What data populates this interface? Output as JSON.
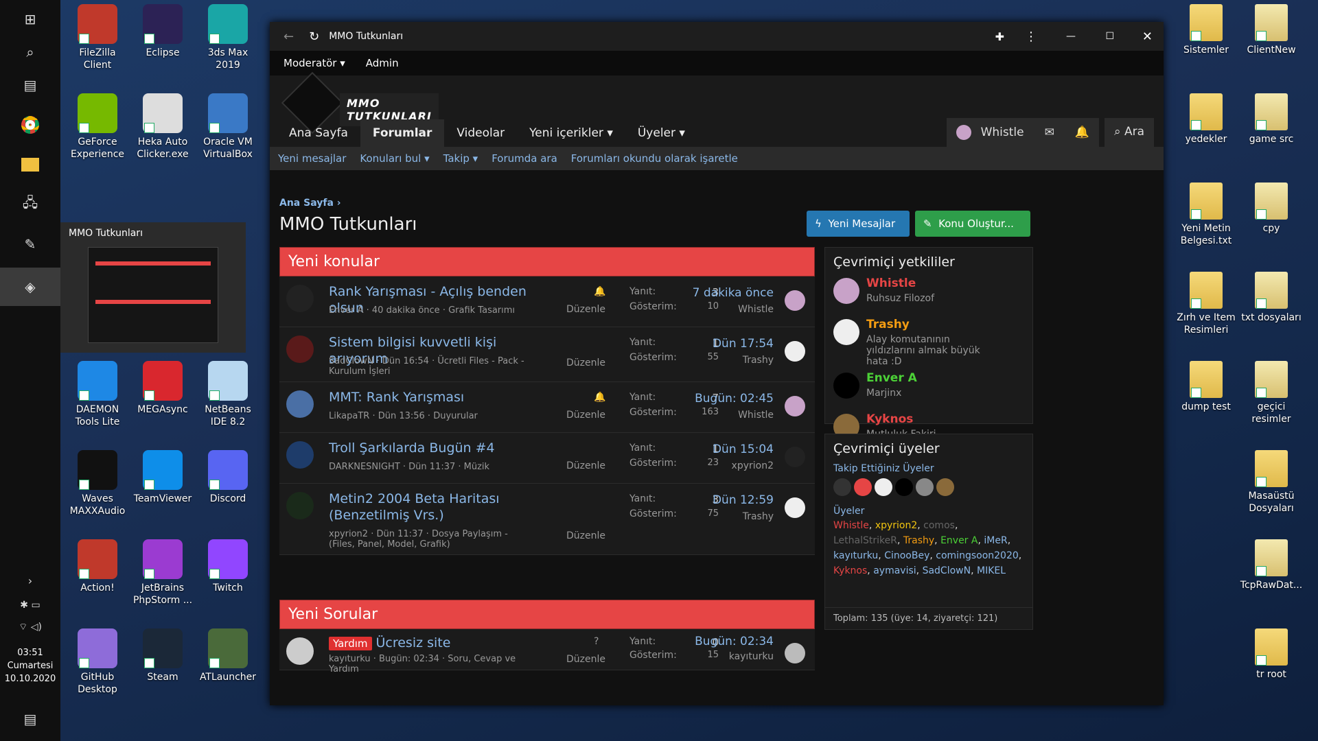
{
  "window_title": "MMO Tutkunları",
  "taskbar": {
    "clock_time": "03:51",
    "clock_day": "Cumartesi",
    "clock_date": "10.10.2020",
    "thumb_title": "MMO Tutkunları"
  },
  "desktop_left": [
    {
      "label": "FileZilla Client",
      "color": "#c0392b"
    },
    {
      "label": "Eclipse",
      "color": "#2c2255"
    },
    {
      "label": "3ds Max 2019",
      "color": "#1aa6a6"
    },
    {
      "label": "GeForce Experience",
      "color": "#76b900"
    },
    {
      "label": "Heka Auto Clicker.exe",
      "color": "#ddd"
    },
    {
      "label": "Oracle VM VirtualBox",
      "color": "#3a79c6"
    },
    {
      "label": "DAEMON Tools Lite",
      "color": "#1e88e5"
    },
    {
      "label": "MEGAsync",
      "color": "#d9272e"
    },
    {
      "label": "NetBeans IDE 8.2",
      "color": "#b7d7f0"
    },
    {
      "label": "Waves MAXXAudio",
      "color": "#111"
    },
    {
      "label": "TeamViewer",
      "color": "#0e8ee9"
    },
    {
      "label": "Discord",
      "color": "#5865f2"
    },
    {
      "label": "Action!",
      "color": "#c0392b"
    },
    {
      "label": "JetBrains PhpStorm ...",
      "color": "#9b3bd1"
    },
    {
      "label": "Twitch",
      "color": "#9146ff"
    },
    {
      "label": "GitHub Desktop",
      "color": "#8e6cd9"
    },
    {
      "label": "Steam",
      "color": "#1b2838"
    },
    {
      "label": "ATLauncher",
      "color": "#4a6a3a"
    }
  ],
  "desktop_right": [
    {
      "label": "Sistemler"
    },
    {
      "label": "ClientNew"
    },
    {
      "label": "yedekler"
    },
    {
      "label": "game src"
    },
    {
      "label": "Yeni Metin Belgesi.txt"
    },
    {
      "label": "cpy"
    },
    {
      "label": "Zırh ve Item Resimleri"
    },
    {
      "label": "txt dosyaları"
    },
    {
      "label": "dump test"
    },
    {
      "label": "geçici resimler"
    },
    {
      "label": "Masaüstü Dosyaları"
    },
    {
      "label": "TcpRawDat..."
    },
    {
      "label": "tr root"
    }
  ],
  "modbar": {
    "moderator": "Moderatör ▾",
    "admin": "Admin"
  },
  "logo_text": "MMO TUTKUNLARI",
  "nav": [
    "Ana Sayfa",
    "Forumlar",
    "Videolar",
    "Yeni içerikler ▾",
    "Üyeler ▾"
  ],
  "nav_user": "Whistle",
  "nav_search": "Ara",
  "subnav": [
    "Yeni mesajlar",
    "Konuları bul ▾",
    "Takip ▾",
    "Forumda ara",
    "Forumları okundu olarak işaretle"
  ],
  "breadcrumb": "Ana Sayfa",
  "page_title": "MMO Tutkunları",
  "btn_new_posts": "Yeni Mesajlar",
  "btn_create": "Konu Oluştur...",
  "section1": "Yeni konular",
  "section2": "Yeni Sorular",
  "labels": {
    "reply": "Yanıt:",
    "views": "Gösterim:",
    "edit": "Düzenle"
  },
  "topics": [
    {
      "title": "Rank Yarışması - Açılış benden olsun",
      "meta": "Enver A · 40 dakika önce · Grafik Tasarımı",
      "replies": "3",
      "views": "10",
      "when": "7 dakika önce",
      "last": "Whistle",
      "bell": true
    },
    {
      "title": "Sistem bilgisi kuvvetli kişi arıyorum",
      "meta": "SadClowN · Dün 16:54 · Ücretli Files - Pack - Kurulum İşleri",
      "replies": "1",
      "views": "55",
      "when": "Dün 17:54",
      "last": "Trashy",
      "bell": false
    },
    {
      "title": "MMT: Rank Yarışması",
      "meta": "LikapaTR · Dün 13:56 · Duyurular",
      "replies": "7",
      "views": "163",
      "when": "Bugün: 02:45",
      "last": "Whistle",
      "bell": true
    },
    {
      "title": "Troll Şarkılarda Bugün #4",
      "meta": "DARKNESNIGHT · Dün 11:37 · Müzik",
      "replies": "1",
      "views": "23",
      "when": "Dün 15:04",
      "last": "xpyrion2",
      "bell": false
    },
    {
      "title": "Metin2 2004 Beta Haritası (Benzetilmiş Vrs.)",
      "meta": "xpyrion2 · Dün 11:37 · Dosya Paylaşım - (Files, Panel, Model, Grafik)",
      "replies": "3",
      "views": "75",
      "when": "Dün 12:59",
      "last": "Trashy",
      "bell": false
    }
  ],
  "question": {
    "tag": "Yardım",
    "title": "Ücresiz site",
    "meta": "kayıturku · Bugün: 02:34 · Soru, Cevap ve Yardım",
    "replies": "0",
    "views": "15",
    "when": "Bugün: 02:34",
    "last": "kayıturku"
  },
  "staff_title": "Çevrimiçi yetkililer",
  "staff": [
    {
      "name": "Whistle",
      "title": "Ruhsuz Filozof",
      "color": "#e64545"
    },
    {
      "name": "Trashy",
      "title": "Alay komutanının yıldızlarını almak büyük hata :D",
      "color": "#f39c12"
    },
    {
      "name": "Enver A",
      "title": "Marjinx",
      "color": "#4cd137"
    },
    {
      "name": "Kyknos",
      "title": "Mutluluk Fakiri",
      "color": "#e64545"
    }
  ],
  "members_title": "Çevrimiçi üyeler",
  "following_label": "Takip Ettiğiniz Üyeler",
  "members_label": "Üyeler",
  "members": [
    {
      "n": "Whistle",
      "c": "#e64545"
    },
    {
      "n": "xpyrion2",
      "c": "#f1c40f"
    },
    {
      "n": "comos",
      "c": "#666"
    },
    {
      "n": "LethalStrikeR",
      "c": "#666"
    },
    {
      "n": "Trashy",
      "c": "#f39c12"
    },
    {
      "n": "Enver A",
      "c": "#4cd137"
    },
    {
      "n": "iMeR",
      "c": "#8bb8e8"
    },
    {
      "n": "kayıturku",
      "c": "#8bb8e8"
    },
    {
      "n": "CinooBey",
      "c": "#8bb8e8"
    },
    {
      "n": "comingsoon2020",
      "c": "#8bb8e8"
    },
    {
      "n": "Kyknos",
      "c": "#e64545"
    },
    {
      "n": "aymavisi",
      "c": "#8bb8e8"
    },
    {
      "n": "SadClowN",
      "c": "#8bb8e8"
    },
    {
      "n": "MIKEL",
      "c": "#8bb8e8"
    }
  ],
  "total": "Toplam: 135 (üye: 14, ziyaretçi: 121)"
}
